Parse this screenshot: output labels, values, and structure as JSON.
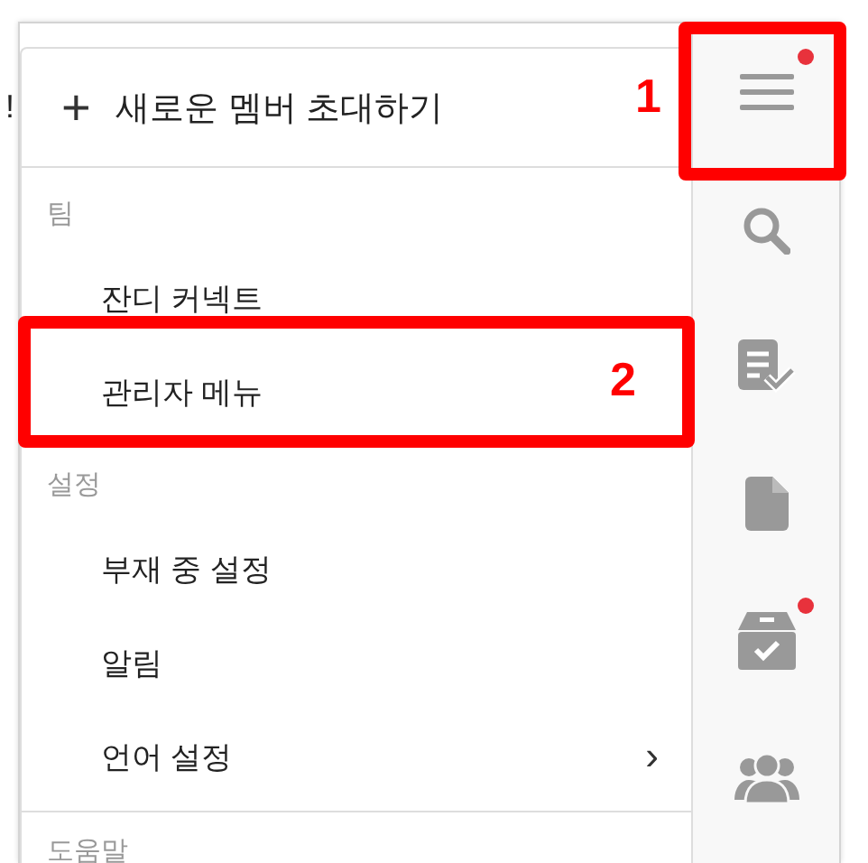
{
  "behind_text": "!",
  "menu": {
    "invite": {
      "icon": "+",
      "label": "새로운 멤버 초대하기"
    },
    "sections": [
      {
        "title": "팀",
        "items": [
          {
            "label": "잔디 커넥트"
          },
          {
            "label": "관리자 메뉴"
          }
        ]
      },
      {
        "title": "설정",
        "items": [
          {
            "label": "부재 중 설정"
          },
          {
            "label": "알림"
          },
          {
            "label": "언어 설정",
            "chevron": "›"
          }
        ]
      },
      {
        "title": "도움말"
      }
    ]
  },
  "sidebar": {
    "items": [
      {
        "kind": "menu",
        "badge": true
      },
      {
        "kind": "search",
        "badge": false
      },
      {
        "kind": "task",
        "badge": false
      },
      {
        "kind": "file",
        "badge": false
      },
      {
        "kind": "archive",
        "badge": true
      },
      {
        "kind": "people",
        "badge": false
      }
    ]
  },
  "callouts": [
    {
      "number": "1"
    },
    {
      "number": "2"
    }
  ]
}
